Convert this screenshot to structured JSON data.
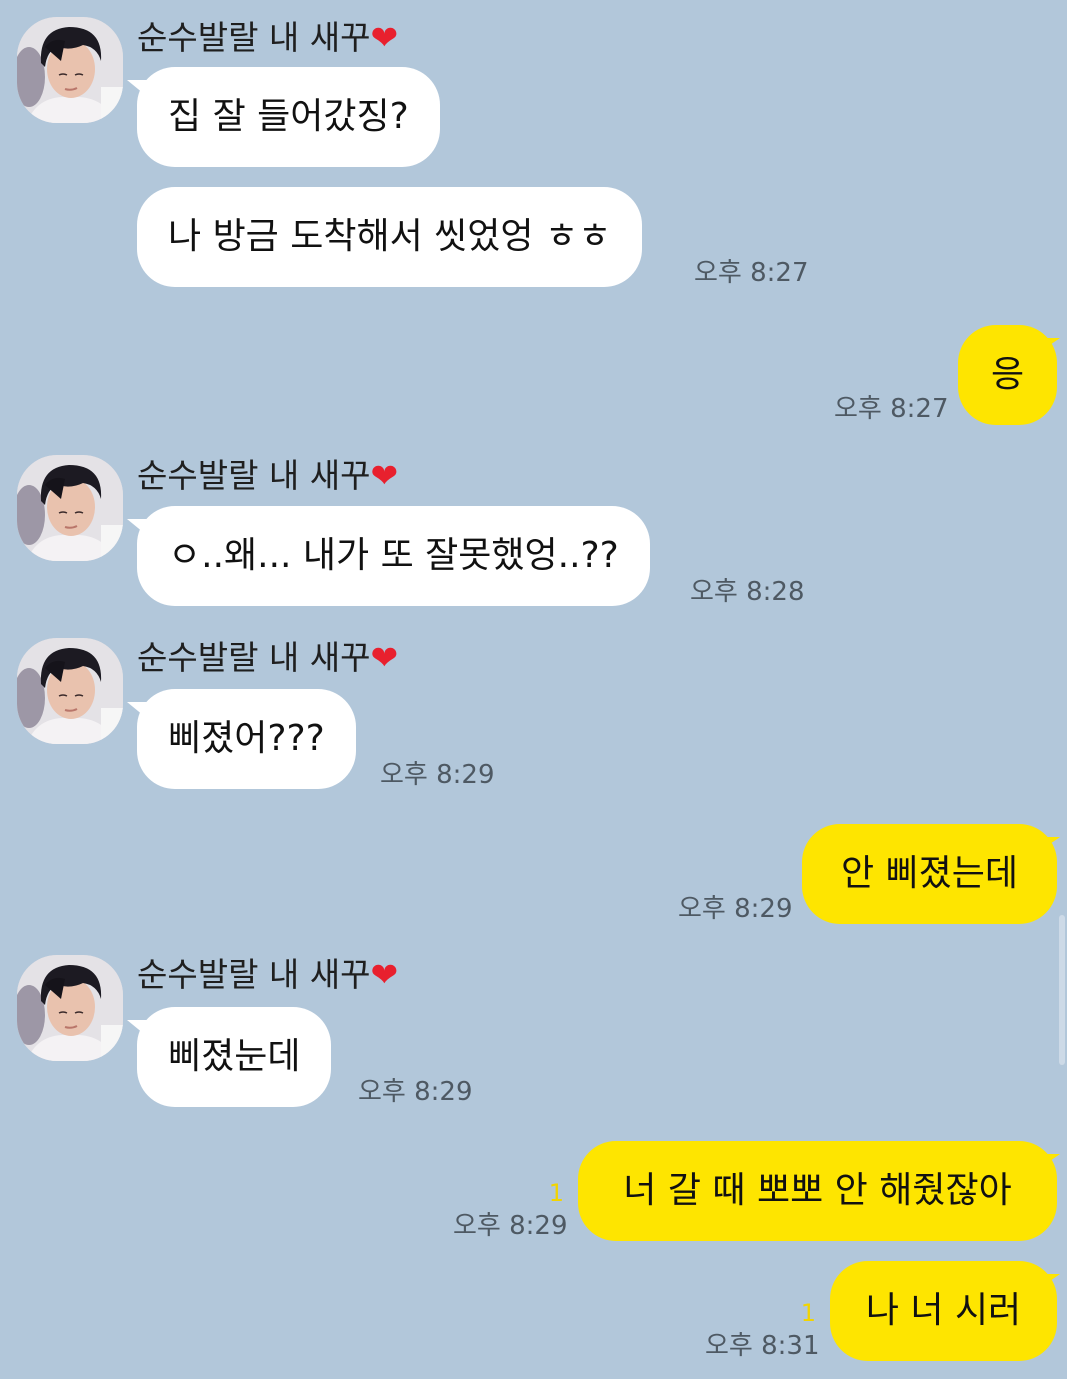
{
  "sender_name": "순수발랄 내 새꾸",
  "sender_heart": "❤",
  "colors": {
    "background": "#b2c7da",
    "incoming_bubble": "#ffffff",
    "outgoing_bubble": "#fee500",
    "unread_count": "#f2d400",
    "heart": "#e8202e"
  },
  "messages": [
    {
      "direction": "in",
      "text": "집 잘 들어갔징?",
      "time": ""
    },
    {
      "direction": "in",
      "text": "나 방금 도착해서 씻었엉 ㅎㅎ",
      "time": "오후 8:27"
    },
    {
      "direction": "out",
      "text": "응",
      "time": "오후 8:27",
      "unread": ""
    },
    {
      "direction": "in",
      "text": "ㅇ..왜... 내가 또 잘못했엉..??",
      "time": "오후 8:28"
    },
    {
      "direction": "in",
      "text": "삐졌어???",
      "time": "오후 8:29"
    },
    {
      "direction": "out",
      "text": "안 삐졌는데",
      "time": "오후 8:29",
      "unread": ""
    },
    {
      "direction": "in",
      "text": "삐졌눈데",
      "time": "오후 8:29"
    },
    {
      "direction": "out",
      "text": "너 갈 때 뽀뽀 안 해줬잖아",
      "time": "오후 8:29",
      "unread": "1"
    },
    {
      "direction": "out",
      "text": "나 너 시러",
      "time": "오후 8:31",
      "unread": "1"
    }
  ]
}
